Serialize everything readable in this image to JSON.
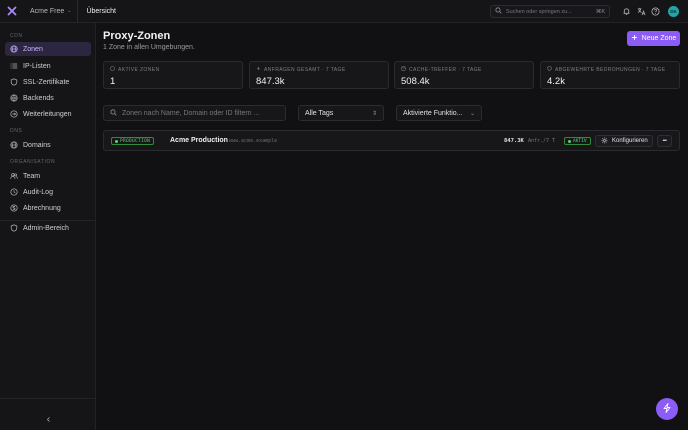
{
  "topbar": {
    "org_name": "Acme Free",
    "breadcrumb": "Übersicht",
    "search_placeholder": "Suchen oder springen zu...",
    "search_shortcut": "⌘K",
    "avatar_initials": "DK"
  },
  "sidebar": {
    "sections": [
      {
        "title": "CDN",
        "items": [
          {
            "label": "Zonen",
            "icon": "globe-icon",
            "active": true
          },
          {
            "label": "IP-Listen",
            "icon": "list-icon"
          },
          {
            "label": "SSL-Zertifikate",
            "icon": "shield-icon"
          },
          {
            "label": "Backends",
            "icon": "server-icon"
          },
          {
            "label": "Weiterleitungen",
            "icon": "redirect-icon"
          }
        ]
      },
      {
        "title": "DNS",
        "items": [
          {
            "label": "Domains",
            "icon": "globe-icon"
          }
        ]
      },
      {
        "title": "ORGANISATION",
        "items": [
          {
            "label": "Team",
            "icon": "users-icon"
          },
          {
            "label": "Audit-Log",
            "icon": "clock-icon"
          },
          {
            "label": "Abrechnung",
            "icon": "card-icon"
          }
        ]
      }
    ],
    "admin_label": "Admin-Bereich"
  },
  "main": {
    "title": "Proxy-Zonen",
    "subtitle": "1 Zone in allen Umgebungen.",
    "new_zone_label": "Neue Zone",
    "stats": [
      {
        "label": "AKTIVE ZONEN",
        "value": "1"
      },
      {
        "label": "ANFRAGEN GESAMT · 7 TAGE",
        "value": "847.3k"
      },
      {
        "label": "CACHE-TREFFER · 7 TAGE",
        "value": "508.4k"
      },
      {
        "label": "ABGEWEHRTE BEDROHUNGEN · 7 TAGE",
        "value": "4.2k"
      }
    ],
    "filters": {
      "search_placeholder": "Zonen nach Name, Domain oder ID filtern ...",
      "tags_value": "Alle Tags",
      "features_value": "Aktivierte Funktio..."
    },
    "zones": [
      {
        "env": "PRODUCTION",
        "name": "Acme Production",
        "domain": "www.acme.example",
        "requests": "847.3K",
        "requests_sub": "Anfr./7 T",
        "status": "AKTIV",
        "configure_label": "Konfigurieren",
        "more_label": "•••"
      }
    ]
  },
  "colors": {
    "accent": "#8b5cf6",
    "active_bg": "#2d2640",
    "success": "#59d36a",
    "background": "#111114"
  }
}
